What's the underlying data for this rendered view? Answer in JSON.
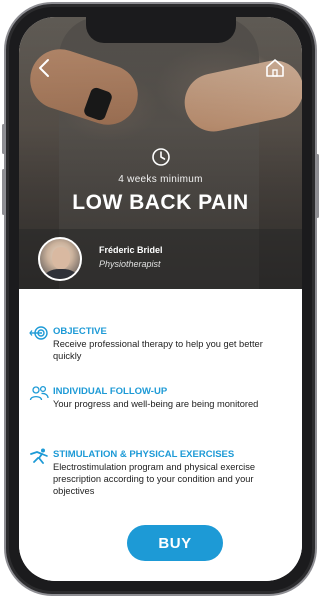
{
  "header": {
    "back_icon": "chevron-left-icon",
    "home_icon": "home-icon",
    "duration_icon": "clock-icon",
    "duration": "4 weeks minimum",
    "title": "LOW BACK PAIN"
  },
  "expert": {
    "name": "Fréderic Bridel",
    "role": "Physiotherapist"
  },
  "features": [
    {
      "icon": "target-icon",
      "title": "OBJECTIVE",
      "description": "Receive professional therapy to help you get better quickly"
    },
    {
      "icon": "people-icon",
      "title": "INDIVIDUAL FOLLOW-UP",
      "description": "Your progress and well-being are being monitored"
    },
    {
      "icon": "exercise-icon",
      "title": "STIMULATION & PHYSICAL EXERCISES",
      "description": "Electrostimulation program and physical exercise prescription according to your condition and your objectives"
    }
  ],
  "cta": {
    "buy_label": "BUY"
  },
  "colors": {
    "accent": "#1d9ad6",
    "frame": "#1b1b1d"
  }
}
